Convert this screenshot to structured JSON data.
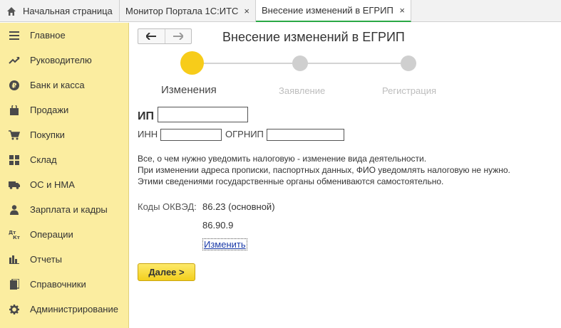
{
  "tabs": {
    "home": "Начальная страница",
    "monitor": "Монитор Портала 1С:ИТС",
    "active": "Внесение изменений в ЕГРИП",
    "close_glyph": "×"
  },
  "sidebar": {
    "items": [
      {
        "label": "Главное",
        "icon": "menu-icon"
      },
      {
        "label": "Руководителю",
        "icon": "trend-icon"
      },
      {
        "label": "Банк и касса",
        "icon": "ruble-icon"
      },
      {
        "label": "Продажи",
        "icon": "bag-icon"
      },
      {
        "label": "Покупки",
        "icon": "cart-icon"
      },
      {
        "label": "Склад",
        "icon": "warehouse-icon"
      },
      {
        "label": "ОС и НМА",
        "icon": "truck-icon"
      },
      {
        "label": "Зарплата и кадры",
        "icon": "person-icon"
      },
      {
        "label": "Операции",
        "icon": "dt-kt-icon"
      },
      {
        "label": "Отчеты",
        "icon": "bar-chart-icon"
      },
      {
        "label": "Справочники",
        "icon": "book-icon"
      },
      {
        "label": "Администрирование",
        "icon": "gear-icon"
      }
    ]
  },
  "main": {
    "title": "Внесение изменений в ЕГРИП",
    "back_glyph": "🡐",
    "forward_glyph": "🡒",
    "steps": [
      {
        "label": "Изменения",
        "active": true
      },
      {
        "label": "Заявление",
        "active": false
      },
      {
        "label": "Регистрация",
        "active": false
      }
    ],
    "ip_label": "ИП",
    "ip_value": "",
    "inn_label": "ИНН",
    "inn_value": "",
    "ogrnip_label": "ОГРНИП",
    "ogrnip_value": "",
    "info_lines": [
      "Все, о чем нужно уведомить налоговую - изменение вида деятельности.",
      "При изменении адреса прописки, паспортных данных, ФИО уведомлять налоговую не нужно.",
      "Этими сведениями государственные органы обмениваются самостоятельно."
    ],
    "okved_label": "Коды ОКВЭД:",
    "okved_codes": [
      "86.23 (основной)",
      "86.90.9"
    ],
    "change_link": "Изменить",
    "next_button": "Далее >"
  },
  "colors": {
    "sidebar_bg": "#fbeda0",
    "active_step": "#f7cc1a",
    "inactive_step": "#cfcfcf",
    "active_tab_underline": "#2aa845",
    "button_yellow": "#f3cf1d",
    "link": "#1a3aa8"
  }
}
